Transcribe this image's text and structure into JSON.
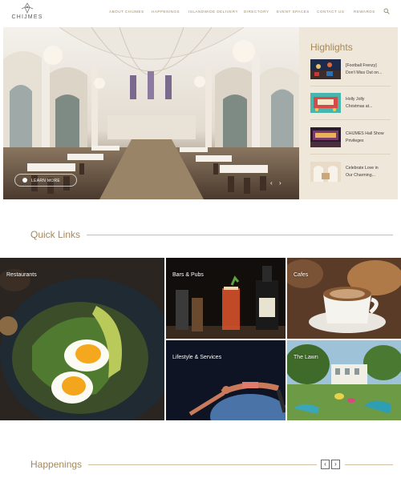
{
  "brand": {
    "logo_text": "CHIJMES"
  },
  "nav": {
    "items": [
      {
        "label": "ABOUT CHIJMES",
        "id": "about"
      },
      {
        "label": "HAPPENINGS",
        "id": "happenings"
      },
      {
        "label": "ISLANDWIDE DELIVERY",
        "id": "delivery"
      },
      {
        "label": "DIRECTORY",
        "id": "directory"
      },
      {
        "label": "EVENT SPACES",
        "id": "event-spaces"
      },
      {
        "label": "CONTACT US",
        "id": "contact"
      },
      {
        "label": "REWARDS",
        "id": "rewards"
      }
    ],
    "search_icon": "search-icon"
  },
  "hero": {
    "learn_more": "LEARN MORE",
    "prev_arrow": "‹",
    "next_arrow": "›"
  },
  "highlights": {
    "title": "Highlights",
    "items": [
      {
        "text_line1": "[Football Frenzy]",
        "text_line2": "Don't Miss Out on..."
      },
      {
        "text_line1": "Holly Jolly",
        "text_line2": "Christmas at..."
      },
      {
        "text_line1": "CHIJMES Hall Show",
        "text_line2": "Privileges"
      },
      {
        "text_line1": "Celebrate Love in",
        "text_line2": "Our Charming..."
      }
    ]
  },
  "quick_links": {
    "title": "Quick Links",
    "tiles": [
      {
        "label": "Restaurants"
      },
      {
        "label": "Bars & Pubs"
      },
      {
        "label": "Cafes"
      },
      {
        "label": "Lifestyle & Services"
      },
      {
        "label": "The Lawn"
      }
    ]
  },
  "happenings": {
    "title": "Happenings",
    "prev": "‹",
    "next": "›"
  },
  "colors": {
    "accent": "#a5895a",
    "highlights_bg": "#efe7da"
  }
}
